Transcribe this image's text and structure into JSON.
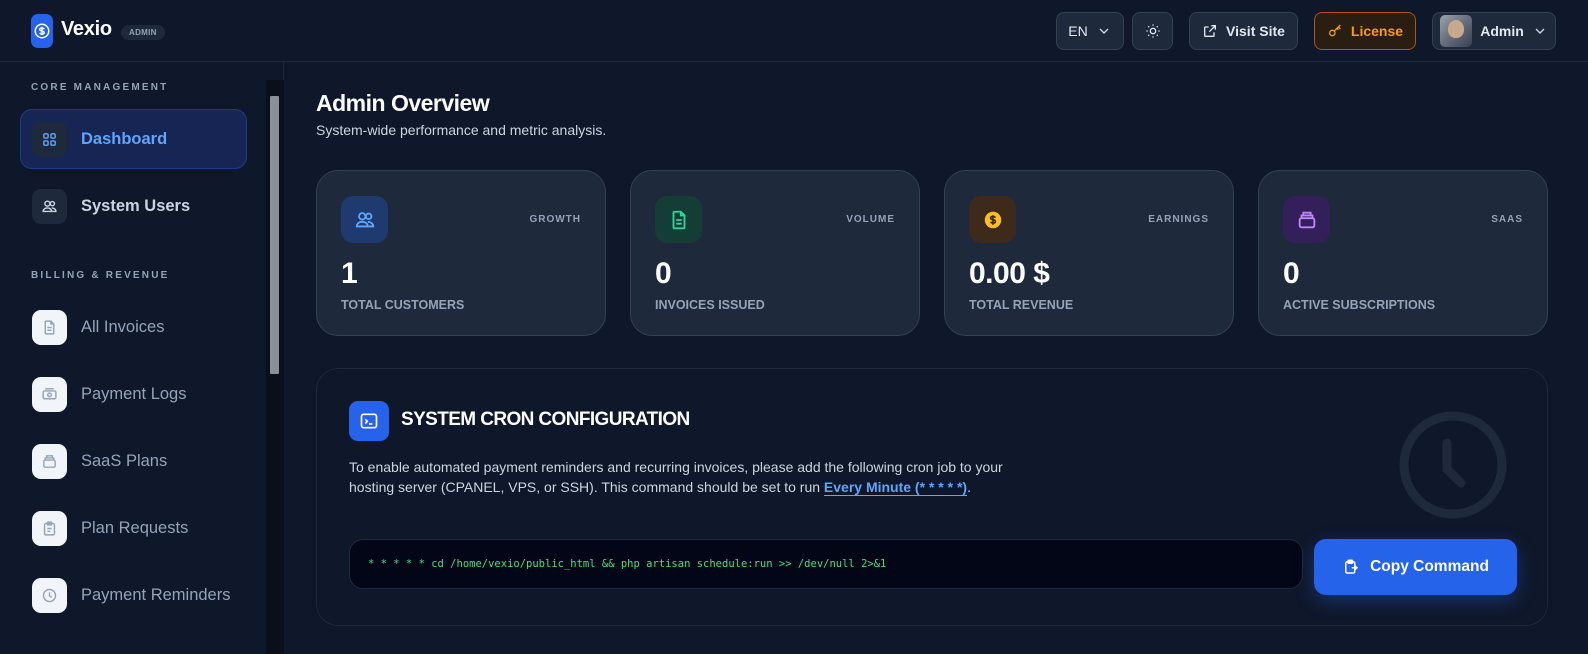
{
  "header": {
    "brand": "Vexio",
    "badge": "ADMIN",
    "lang": "EN",
    "visit_site": "Visit Site",
    "license": "License",
    "user": "Admin"
  },
  "sidebar": {
    "sections": [
      {
        "title": "CORE MANAGEMENT"
      },
      {
        "title": "BILLING & REVENUE"
      }
    ],
    "items": [
      {
        "label": "Dashboard",
        "icon": "grid-icon"
      },
      {
        "label": "System Users",
        "icon": "users-icon"
      },
      {
        "label": "All Invoices",
        "icon": "file-icon"
      },
      {
        "label": "Payment Logs",
        "icon": "money-icon"
      },
      {
        "label": "SaaS Plans",
        "icon": "box-icon"
      },
      {
        "label": "Plan Requests",
        "icon": "clipboard-icon"
      },
      {
        "label": "Payment Reminders",
        "icon": "clock-icon"
      }
    ]
  },
  "main": {
    "title": "Admin Overview",
    "subtitle": "System-wide performance and metric analysis.",
    "cards": [
      {
        "tag": "GROWTH",
        "value": "1",
        "label": "TOTAL CUSTOMERS",
        "icon_color": "#60a5fa",
        "bg": "#1e3a6e"
      },
      {
        "tag": "VOLUME",
        "value": "0",
        "label": "INVOICES ISSUED",
        "icon_color": "#34d399",
        "bg": "#143d36"
      },
      {
        "tag": "EARNINGS",
        "value": "0.00 $",
        "label": "TOTAL REVENUE",
        "icon_color": "#fbbf24",
        "bg": "#3d2a1a"
      },
      {
        "tag": "SAAS",
        "value": "0",
        "label": "ACTIVE SUBSCRIPTIONS",
        "icon_color": "#c084fc",
        "bg": "#33205a"
      }
    ],
    "cron": {
      "title": "SYSTEM CRON CONFIGURATION",
      "text": "To enable automated payment reminders and recurring invoices, please add the following cron job to your hosting server (CPANEL, VPS, or SSH). This command should be set to run ",
      "highlight": "Every Minute (* * * * *)",
      "text_end": ".",
      "command": "* * * * * cd /home/vexio/public_html && php artisan schedule:run >> /dev/null 2>&1",
      "copy_label": "Copy Command"
    }
  }
}
